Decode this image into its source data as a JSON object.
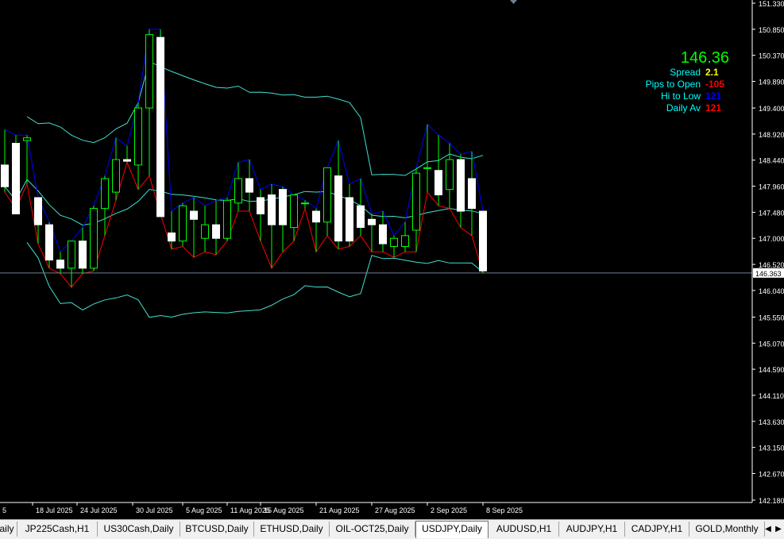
{
  "chart_data": {
    "type": "candlestick",
    "symbol": "USDJPY",
    "timeframe": "Daily",
    "y_ticks": [
      "151.330",
      "150.850",
      "150.370",
      "149.890",
      "149.400",
      "148.920",
      "148.440",
      "147.960",
      "147.480",
      "147.000",
      "146.520",
      "146.040",
      "145.550",
      "145.070",
      "144.590",
      "144.110",
      "143.630",
      "143.150",
      "142.670",
      "142.180"
    ],
    "x_ticks": [
      "5",
      "18 Jul 2025",
      "24 Jul 2025",
      "30 Jul 2025",
      "5 Aug 2025",
      "11 Aug 2025",
      "15 Aug 2025",
      "21 Aug 2025",
      "27 Aug 2025",
      "2 Sep 2025",
      "8 Sep 2025"
    ],
    "current_price_label": "146.363",
    "current_price": 146.363,
    "candles": [
      {
        "o": 148.35,
        "h": 149.0,
        "l": 147.85,
        "c": 147.95
      },
      {
        "o": 148.75,
        "h": 148.9,
        "l": 147.55,
        "c": 147.45
      },
      {
        "o": 148.8,
        "h": 148.9,
        "l": 148.0,
        "c": 148.85
      },
      {
        "o": 147.75,
        "h": 147.75,
        "l": 146.9,
        "c": 147.25
      },
      {
        "o": 147.25,
        "h": 147.3,
        "l": 146.45,
        "c": 146.6
      },
      {
        "o": 146.6,
        "h": 146.75,
        "l": 146.35,
        "c": 146.45
      },
      {
        "o": 146.45,
        "h": 146.95,
        "l": 146.1,
        "c": 146.95
      },
      {
        "o": 146.95,
        "h": 147.2,
        "l": 146.35,
        "c": 146.45
      },
      {
        "o": 146.45,
        "h": 147.6,
        "l": 146.4,
        "c": 147.55
      },
      {
        "o": 147.55,
        "h": 148.15,
        "l": 147.05,
        "c": 148.1
      },
      {
        "o": 147.85,
        "h": 148.85,
        "l": 147.7,
        "c": 148.45
      },
      {
        "o": 148.45,
        "h": 148.7,
        "l": 148.4,
        "c": 148.42
      },
      {
        "o": 148.35,
        "h": 149.5,
        "l": 147.9,
        "c": 149.4
      },
      {
        "o": 149.4,
        "h": 150.85,
        "l": 148.15,
        "c": 150.75
      },
      {
        "o": 150.7,
        "h": 150.85,
        "l": 147.45,
        "c": 147.4
      },
      {
        "o": 147.1,
        "h": 147.5,
        "l": 146.8,
        "c": 146.95
      },
      {
        "o": 146.95,
        "h": 147.65,
        "l": 146.85,
        "c": 147.6
      },
      {
        "o": 147.5,
        "h": 147.75,
        "l": 146.65,
        "c": 147.35
      },
      {
        "o": 147.0,
        "h": 147.6,
        "l": 146.75,
        "c": 147.25
      },
      {
        "o": 147.25,
        "h": 147.7,
        "l": 146.7,
        "c": 147.0
      },
      {
        "o": 147.0,
        "h": 147.75,
        "l": 146.95,
        "c": 147.7
      },
      {
        "o": 147.65,
        "h": 148.4,
        "l": 147.5,
        "c": 148.1
      },
      {
        "o": 148.1,
        "h": 148.45,
        "l": 147.5,
        "c": 147.85
      },
      {
        "o": 147.75,
        "h": 147.9,
        "l": 146.95,
        "c": 147.45
      },
      {
        "o": 147.8,
        "h": 148.0,
        "l": 146.45,
        "c": 147.25
      },
      {
        "o": 147.9,
        "h": 147.95,
        "l": 146.75,
        "c": 147.25
      },
      {
        "o": 147.2,
        "h": 147.8,
        "l": 146.95,
        "c": 147.8
      },
      {
        "o": 147.65,
        "h": 147.7,
        "l": 147.55,
        "c": 147.65
      },
      {
        "o": 147.5,
        "h": 147.55,
        "l": 146.75,
        "c": 147.3
      },
      {
        "o": 147.3,
        "h": 148.3,
        "l": 147.05,
        "c": 148.3
      },
      {
        "o": 148.15,
        "h": 148.8,
        "l": 146.8,
        "c": 146.95
      },
      {
        "o": 147.75,
        "h": 148.0,
        "l": 146.85,
        "c": 146.95
      },
      {
        "o": 147.6,
        "h": 148.1,
        "l": 147.05,
        "c": 147.2
      },
      {
        "o": 147.35,
        "h": 147.45,
        "l": 146.75,
        "c": 147.25
      },
      {
        "o": 147.25,
        "h": 147.5,
        "l": 146.75,
        "c": 146.9
      },
      {
        "o": 146.85,
        "h": 147.05,
        "l": 146.65,
        "c": 147.0
      },
      {
        "o": 146.85,
        "h": 147.3,
        "l": 146.75,
        "c": 147.05
      },
      {
        "o": 147.15,
        "h": 148.3,
        "l": 146.75,
        "c": 148.2
      },
      {
        "o": 148.3,
        "h": 149.1,
        "l": 147.85,
        "c": 148.3
      },
      {
        "o": 148.25,
        "h": 148.9,
        "l": 147.6,
        "c": 147.8
      },
      {
        "o": 147.9,
        "h": 148.75,
        "l": 147.55,
        "c": 148.45
      },
      {
        "o": 148.45,
        "h": 148.55,
        "l": 147.2,
        "c": 147.5
      },
      {
        "o": 148.1,
        "h": 148.6,
        "l": 147.05,
        "c": 147.55
      },
      {
        "o": 147.5,
        "h": 147.5,
        "l": 146.36,
        "c": 146.4
      }
    ]
  },
  "info_panel": {
    "price": "146.36",
    "rows": [
      {
        "label": "Spread",
        "value": "2.1",
        "color": "#ffff00"
      },
      {
        "label": "Pips to Open",
        "value": "-105",
        "color": "#ff0000"
      },
      {
        "label": "Hi to Low",
        "value": "121",
        "color": "#0000ff"
      },
      {
        "label": "Daily Av",
        "value": "121",
        "color": "#ff0000"
      }
    ]
  },
  "colors": {
    "background": "#000000",
    "axis": "#ffffff",
    "bull_body": "#000000",
    "bear_body": "#ffffff",
    "wick": "#00ff00",
    "bollinger": "#40e0d0",
    "envelope_high": "#0000ff",
    "envelope_low": "#ff0000",
    "price_line": "#708090",
    "label_cyan": "#00ffff",
    "price_green": "#00ff00"
  },
  "tabs": [
    {
      "label": "aily",
      "active": false
    },
    {
      "label": "JP225Cash,H1",
      "active": false
    },
    {
      "label": "US30Cash,Daily",
      "active": false
    },
    {
      "label": "BTCUSD,Daily",
      "active": false
    },
    {
      "label": "ETHUSD,Daily",
      "active": false
    },
    {
      "label": "OIL-OCT25,Daily",
      "active": false
    },
    {
      "label": "USDJPY,Daily",
      "active": true
    },
    {
      "label": "AUDUSD,H1",
      "active": false
    },
    {
      "label": "AUDJPY,H1",
      "active": false
    },
    {
      "label": "CADJPY,H1",
      "active": false
    },
    {
      "label": "GOLD,Monthly",
      "active": false
    }
  ],
  "tab_nav": {
    "left": "◀",
    "right": "▶"
  }
}
